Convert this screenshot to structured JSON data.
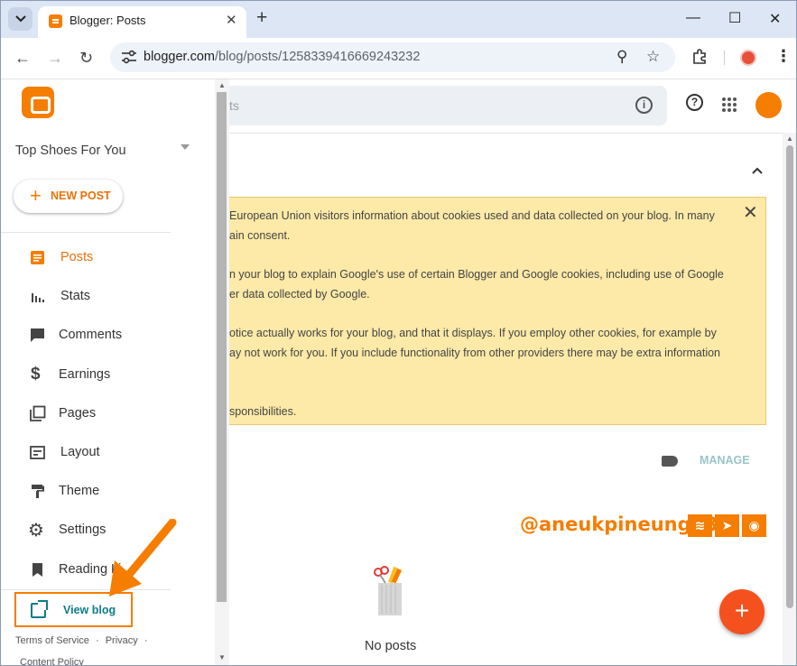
{
  "browser": {
    "tab_title": "Blogger: Posts",
    "url_domain": "blogger.com",
    "url_path": "/blog/posts/1258339416669243232",
    "icons": [
      "tab-list-icon",
      "close-icon",
      "new-tab-icon",
      "minimize-icon",
      "maximize-icon",
      "window-close-icon",
      "back-icon",
      "forward-icon",
      "reload-icon",
      "site-info-icon",
      "zoom-icon",
      "bookmark-star-icon",
      "extensions-icon",
      "profile-icon",
      "menu-icon"
    ]
  },
  "sidebar": {
    "blog_name": "Top Shoes For You",
    "new_post_label": "NEW POST",
    "items": [
      {
        "label": "Posts",
        "icon": "posts-icon",
        "active": true
      },
      {
        "label": "Stats",
        "icon": "stats-icon",
        "active": false
      },
      {
        "label": "Comments",
        "icon": "comments-icon",
        "active": false
      },
      {
        "label": "Earnings",
        "icon": "dollar-icon",
        "active": false
      },
      {
        "label": "Pages",
        "icon": "pages-icon",
        "active": false
      },
      {
        "label": "Layout",
        "icon": "layout-icon",
        "active": false
      },
      {
        "label": "Theme",
        "icon": "theme-icon",
        "active": false
      },
      {
        "label": "Settings",
        "icon": "gear-icon",
        "active": false
      },
      {
        "label": "Reading Li",
        "icon": "bookmark-icon",
        "active": false
      }
    ],
    "view_blog_label": "View blog",
    "footer_terms": "Terms of Service",
    "footer_sep": "·",
    "footer_privacy": "Privacy",
    "footer_sep2": "·",
    "footer_content": "Content Policy"
  },
  "header": {
    "search_placeholder_fragment": "ts",
    "info_glyph": "i",
    "help_glyph": "?"
  },
  "notice": {
    "lines": [
      "European Union visitors information about cookies used and data collected on your blog. In many",
      "ain consent.",
      "n your blog to explain Google's use of certain Blogger and Google cookies, including use of Google",
      "er data collected by Google.",
      "otice actually works for your blog, and that it displays. If you employ other cookies, for example by",
      "ay not work for you. If you include functionality from other providers there may be extra information",
      "sponsibilities."
    ],
    "close_glyph": "✕"
  },
  "posts": {
    "manage_label": "MANAGE",
    "empty_label": "No posts",
    "watermark": "@aneukpineung78",
    "fab_glyph": "+"
  },
  "colors": {
    "accent": "#f57d00",
    "active_text": "#e8710a",
    "view_blog": "#0e7c86",
    "notice_bg": "#fdeaa8",
    "fab": "#f4511e"
  }
}
